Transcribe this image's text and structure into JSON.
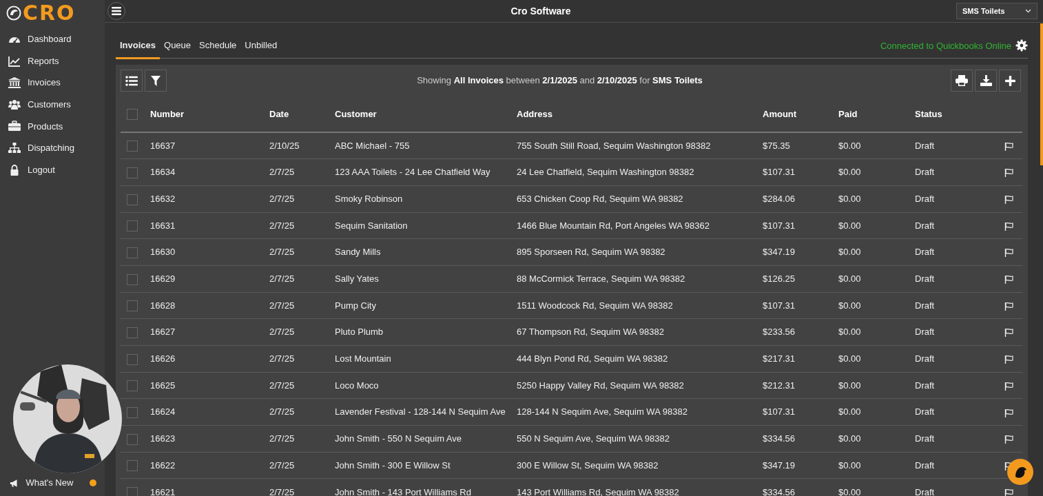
{
  "brand": {
    "logo_text": "CRO"
  },
  "sidebar": {
    "items": [
      {
        "label": "Dashboard",
        "selected": false
      },
      {
        "label": "Reports",
        "selected": false
      },
      {
        "label": "Invoices",
        "selected": false
      },
      {
        "label": "Customers",
        "selected": false
      },
      {
        "label": "Products",
        "selected": false
      },
      {
        "label": "Dispatching",
        "selected": false
      },
      {
        "label": "Logout",
        "selected": false
      }
    ],
    "whats_new": {
      "label": "What's New",
      "unread": true
    }
  },
  "header": {
    "title": "Cro Software",
    "company_select": {
      "value": "SMS Toilets"
    }
  },
  "tabs": [
    {
      "label": "Invoices",
      "selected": true
    },
    {
      "label": "Queue",
      "selected": false
    },
    {
      "label": "Schedule",
      "selected": false
    },
    {
      "label": "Unbilled",
      "selected": false
    }
  ],
  "quickbooks_status": "Connected to Quickbooks Online",
  "summary": "Showing **All** **Invoices** between **2/1/2025** and **2/10/2025** for **SMS Toilets**",
  "table": {
    "columns": [
      "Number",
      "Date",
      "Customer",
      "Address",
      "Amount",
      "Paid",
      "Status"
    ],
    "select_all_checked": false,
    "rows": [
      {
        "number": "16637",
        "date": "2/10/25",
        "customer": "ABC Michael - 755",
        "address": "755 South Still Road, Sequim Washington 98382",
        "amount": "$75.35",
        "paid": "$0.00",
        "status": "Draft",
        "checked": false
      },
      {
        "number": "16634",
        "date": "2/7/25",
        "customer": "123 AAA Toilets - 24 Lee Chatfield Way",
        "address": "24 Lee Chatfield, Sequim Washington 98382",
        "amount": "$107.31",
        "paid": "$0.00",
        "status": "Draft",
        "checked": false
      },
      {
        "number": "16632",
        "date": "2/7/25",
        "customer": "Smoky Robinson",
        "address": "653 Chicken Coop Rd, Sequim WA 98382",
        "amount": "$284.06",
        "paid": "$0.00",
        "status": "Draft",
        "checked": false
      },
      {
        "number": "16631",
        "date": "2/7/25",
        "customer": "Sequim Sanitation",
        "address": "1466 Blue Mountain Rd, Port Angeles WA 98362",
        "amount": "$107.31",
        "paid": "$0.00",
        "status": "Draft",
        "checked": false
      },
      {
        "number": "16630",
        "date": "2/7/25",
        "customer": "Sandy Mills",
        "address": "895 Sporseen Rd, Sequim WA 98382",
        "amount": "$347.19",
        "paid": "$0.00",
        "status": "Draft",
        "checked": false
      },
      {
        "number": "16629",
        "date": "2/7/25",
        "customer": "Sally Yates",
        "address": "88 McCormick Terrace, Sequim WA 98382",
        "amount": "$126.25",
        "paid": "$0.00",
        "status": "Draft",
        "checked": false
      },
      {
        "number": "16628",
        "date": "2/7/25",
        "customer": "Pump City",
        "address": "1511 Woodcock Rd, Sequim WA 98382",
        "amount": "$107.31",
        "paid": "$0.00",
        "status": "Draft",
        "checked": false
      },
      {
        "number": "16627",
        "date": "2/7/25",
        "customer": "Pluto Plumb",
        "address": "67 Thompson Rd, Sequim WA 98382",
        "amount": "$233.56",
        "paid": "$0.00",
        "status": "Draft",
        "checked": false
      },
      {
        "number": "16626",
        "date": "2/7/25",
        "customer": "Lost Mountain",
        "address": "444 Blyn Pond Rd, Sequim WA 98382",
        "amount": "$217.31",
        "paid": "$0.00",
        "status": "Draft",
        "checked": false
      },
      {
        "number": "16625",
        "date": "2/7/25",
        "customer": "Loco Moco",
        "address": "5250 Happy Valley Rd, Sequim WA 98382",
        "amount": "$212.31",
        "paid": "$0.00",
        "status": "Draft",
        "checked": false
      },
      {
        "number": "16624",
        "date": "2/7/25",
        "customer": "Lavender Festival - 128-144 N Sequim Ave",
        "address": "128-144 N Sequim Ave, Sequim WA 98382",
        "amount": "$107.31",
        "paid": "$0.00",
        "status": "Draft",
        "checked": false
      },
      {
        "number": "16623",
        "date": "2/7/25",
        "customer": "John Smith - 550 N Sequim Ave",
        "address": "550 N Sequim Ave, Sequim WA 98382",
        "amount": "$334.56",
        "paid": "$0.00",
        "status": "Draft",
        "checked": false
      },
      {
        "number": "16622",
        "date": "2/7/25",
        "customer": "John Smith - 300 E Willow St",
        "address": "300 E Willow St, Sequim WA 98382",
        "amount": "$347.19",
        "paid": "$0.00",
        "status": "Draft",
        "checked": false
      },
      {
        "number": "16621",
        "date": "2/7/25",
        "customer": "John Smith - 143 Port Williams Rd",
        "address": "143 Port Williams Rd, Sequim WA 98382",
        "amount": "$334.56",
        "paid": "$0.00",
        "status": "Draft",
        "checked": false
      }
    ]
  }
}
